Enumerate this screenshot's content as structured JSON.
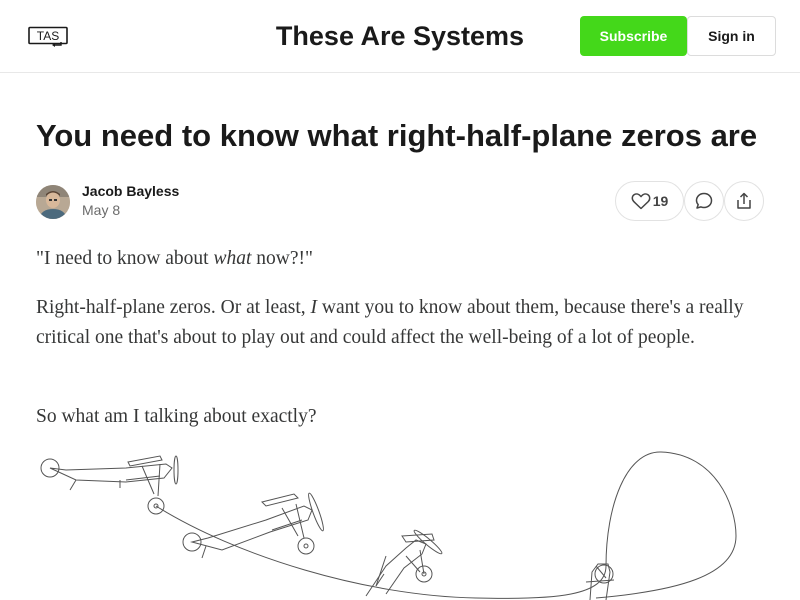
{
  "header": {
    "logo_text": "TAS",
    "site_title": "These Are Systems",
    "subscribe_label": "Subscribe",
    "signin_label": "Sign in"
  },
  "post": {
    "title": "You need to know what right-half-plane zeros are",
    "author": "Jacob Bayless",
    "date": "May 8",
    "like_count": "19",
    "paragraphs": {
      "p1_before": "\"I need to know about ",
      "p1_em": "what",
      "p1_after": " now?!\"",
      "p2_before": "Right-half-plane zeros. Or at least, ",
      "p2_em": "I",
      "p2_after": " want you to know about them, because there's a really critical one that's about to play out and could affect the well-being of a lot of people.",
      "p3": "So what am I talking about exactly?"
    }
  },
  "icons": {
    "like": "heart-icon",
    "comment": "comment-icon",
    "share": "share-icon",
    "logo": "tas-logo"
  },
  "colors": {
    "accent": "#44d81a",
    "text": "#1a1a1a",
    "body_text": "#363737",
    "muted": "#6b6b6b",
    "border": "#e2e2e2"
  }
}
